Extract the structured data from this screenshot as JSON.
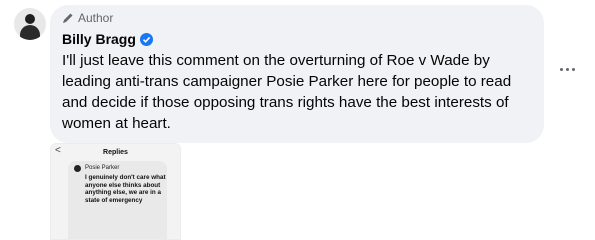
{
  "comment": {
    "badge_label": "Author",
    "author_name": "Billy Bragg",
    "text": "I'll just leave this comment on the overturning of Roe v Wade by leading anti-trans campaigner Posie Parker here for people to read and decide if those opposing trans rights have the best interests of women at heart.",
    "icons": {
      "badge": "pencil-icon",
      "verified": "verified-badge-icon",
      "more": "more-options-icon"
    },
    "colors": {
      "bubble": "#f0f2f5",
      "verified": "#1877f2",
      "meta": "#65676b"
    }
  },
  "attachment": {
    "back": "<",
    "title": "Replies",
    "reply_author": "Posie Parker",
    "reply_text": "I genuinely don't care what anyone else thinks about anything else, we are in a state of emergency"
  }
}
